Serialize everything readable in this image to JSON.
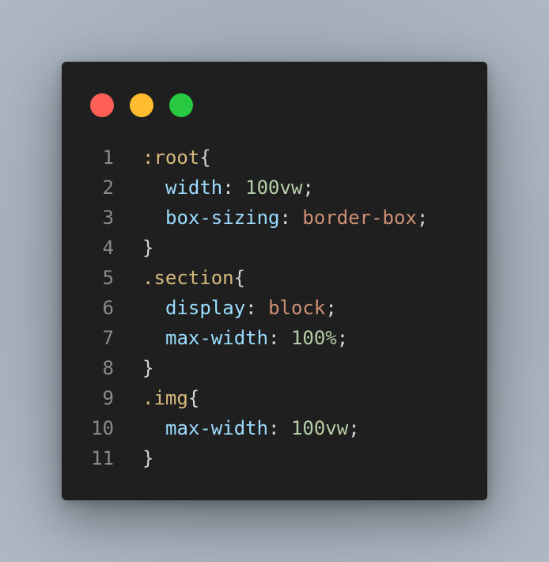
{
  "window": {
    "buttons": [
      {
        "name": "close",
        "color": "#ff5f57"
      },
      {
        "name": "minimize",
        "color": "#febc2e"
      },
      {
        "name": "maximize",
        "color": "#28c840"
      }
    ]
  },
  "editor": {
    "lines": [
      {
        "number": "1",
        "selector": ":root",
        "open": "{"
      },
      {
        "number": "2",
        "property": "width",
        "colon": ": ",
        "value": "100vw",
        "end": ";"
      },
      {
        "number": "3",
        "property": "box-sizing",
        "colon": ": ",
        "value": "border-box",
        "end": ";"
      },
      {
        "number": "4",
        "close": "}"
      },
      {
        "number": "5",
        "selector": ".section",
        "open": "{"
      },
      {
        "number": "6",
        "property": "display",
        "colon": ": ",
        "value": "block",
        "end": ";"
      },
      {
        "number": "7",
        "property": "max-width",
        "colon": ": ",
        "value": "100%",
        "end": ";"
      },
      {
        "number": "8",
        "close": "}"
      },
      {
        "number": "9",
        "selector": ".img",
        "open": "{"
      },
      {
        "number": "10",
        "property": "max-width",
        "colon": ": ",
        "value": "100vw",
        "end": ";"
      },
      {
        "number": "11",
        "close": "}"
      }
    ]
  },
  "colors": {
    "selector": "#d7ba7d",
    "property": "#9cdcfe",
    "number": "#b5cea8",
    "keyword": "#ce9178",
    "punctuation": "#d4d4d4",
    "line_number": "#8a8a8a",
    "background": "#1f1f1f"
  }
}
